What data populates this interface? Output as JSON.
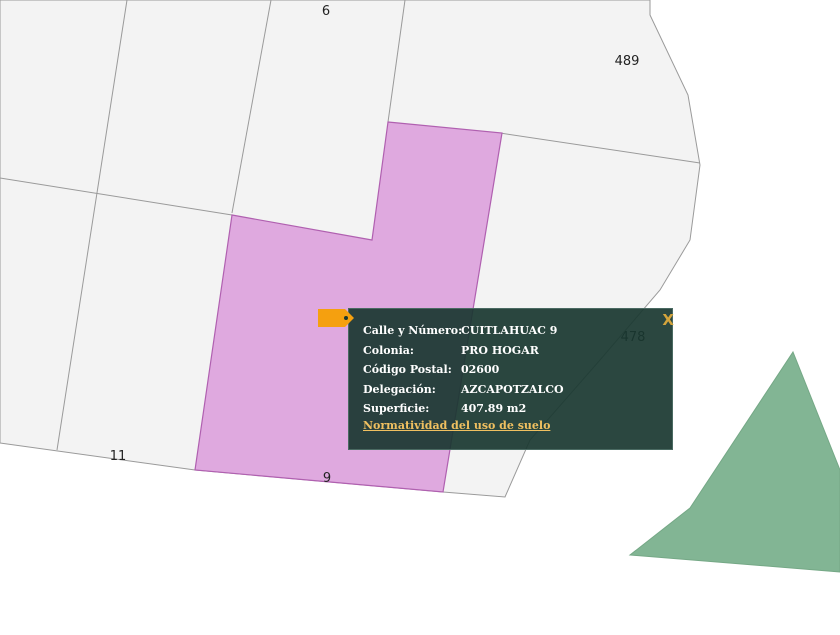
{
  "map": {
    "colors": {
      "lot_fill": "#f3f3f3",
      "lot_stroke": "#9a9a9a",
      "selected_fill": "#dfa9df",
      "selected_stroke": "#b060b0",
      "green_area": "#82b594",
      "popup_bg": "#193730",
      "link": "#f0c060",
      "pointer": "#f5a00f"
    },
    "lot_labels": {
      "lot_6": "6",
      "lot_489": "489",
      "lot_478": "478",
      "lot_11": "11",
      "lot_9": "9"
    }
  },
  "popup": {
    "rows": [
      {
        "label": "Calle y Número:",
        "value": "CUITLAHUAC 9"
      },
      {
        "label": "Colonia:",
        "value": "PRO HOGAR"
      },
      {
        "label": "Código Postal:",
        "value": "02600"
      },
      {
        "label": "Delegación:",
        "value": "AZCAPOTZALCO"
      },
      {
        "label": "Superficie:",
        "value": "407.89 m2"
      }
    ],
    "link_text": "Normatividad del uso de suelo",
    "close_label": "X",
    "pointer_icon": "location-tag-icon"
  }
}
